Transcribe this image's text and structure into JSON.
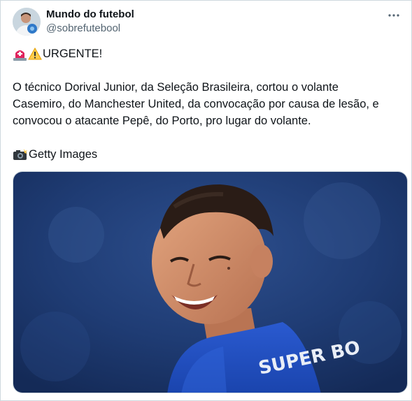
{
  "author": {
    "display_name": "Mundo do futebol",
    "handle": "@sobrefutebool",
    "avatar_icon": "profile-photo-icon"
  },
  "menu": {
    "icon": "more-options-icon"
  },
  "post": {
    "headline_icons": [
      "siren-icon",
      "warning-icon"
    ],
    "headline": "URGENTE!",
    "lines": [
      "O técnico Dorival Junior, da Seleção Brasileira, cortou o volante",
      "Casemiro, do Manchester United, da convocação por causa de lesão, e",
      "convocou o atacante Pepê, do Porto, pro lugar do volante."
    ],
    "credit_icon": "camera-flash-icon",
    "credit": "Getty Images"
  },
  "media": {
    "jersey_text": "SUPER BO",
    "colors": {
      "background": "#1c3c78",
      "jersey": "#1f4fc4"
    }
  }
}
